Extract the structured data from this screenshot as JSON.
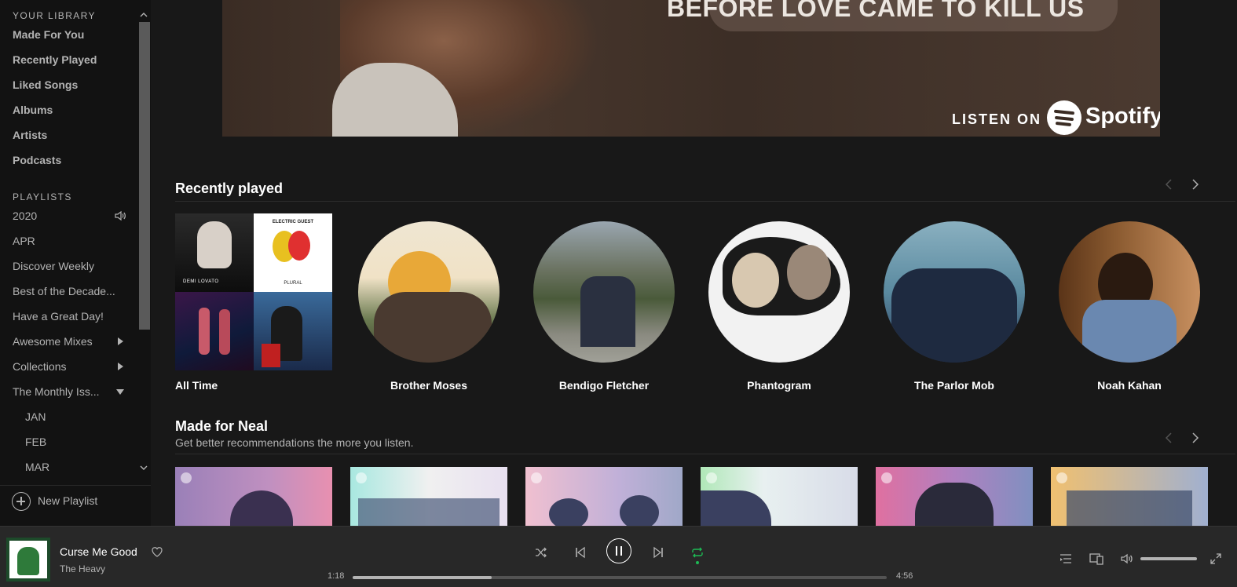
{
  "sidebar": {
    "library_title": "YOUR LIBRARY",
    "library_items": [
      "Made For You",
      "Recently Played",
      "Liked Songs",
      "Albums",
      "Artists",
      "Podcasts"
    ],
    "playlists_title": "PLAYLISTS",
    "playlists": [
      "2020",
      "APR",
      "Discover Weekly",
      "Best of the Decade...",
      "Have a Great Day!",
      "Awesome Mixes",
      "Collections",
      "The Monthly Iss..."
    ],
    "sub_playlists": [
      "JAN",
      "FEB",
      "MAR"
    ],
    "new_playlist": "New Playlist"
  },
  "banner": {
    "headline": "BEFORE LOVE CAME TO KILL US",
    "listen_on": "LISTEN ON",
    "brand": "Spotify"
  },
  "recently_played": {
    "title": "Recently played",
    "items": [
      "All Time",
      "Brother Moses",
      "Bendigo Fletcher",
      "Phantogram",
      "The Parlor Mob",
      "Noah Kahan"
    ],
    "mosaic_text": [
      "DEMI LOVATO",
      "ELECTRIC GUEST",
      "PLURAL"
    ]
  },
  "made_for": {
    "title": "Made for Neal",
    "subtitle": "Get better recommendations the more you listen."
  },
  "player": {
    "track_title": "Curse Me Good",
    "track_artist": "The Heavy",
    "elapsed": "1:18",
    "duration": "4:56",
    "progress": 0.26,
    "volume": 1.0,
    "accent": "#1db954"
  },
  "icons": [
    "heart-icon",
    "shuffle-icon",
    "previous-icon",
    "pause-icon",
    "next-icon",
    "repeat-icon",
    "queue-icon",
    "devices-icon",
    "volume-icon",
    "fullscreen-icon",
    "speaker-icon",
    "chevron-left-icon",
    "chevron-right-icon",
    "triangle-right-icon",
    "triangle-down-icon",
    "plus-circle-icon"
  ]
}
